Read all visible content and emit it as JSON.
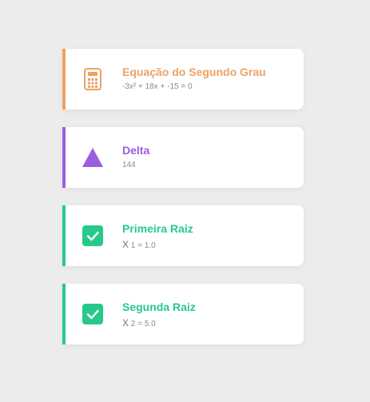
{
  "colors": {
    "background": "#ececec",
    "equation_accent": "#eba266",
    "delta_accent": "#9c5ce0",
    "root_accent": "#27c98a"
  },
  "cards": [
    {
      "icon": "calculator-icon",
      "title": "Equação do Segundo Grau",
      "subtitle": "-3x² + 18x + -15 = 0"
    },
    {
      "icon": "triangle-icon",
      "title": "Delta",
      "subtitle": "144"
    },
    {
      "icon": "checkbox-checked-icon",
      "title": "Primeira Raiz",
      "symbol": "X",
      "subtitle": "1 = 1.0"
    },
    {
      "icon": "checkbox-checked-icon",
      "title": "Segunda Raiz",
      "symbol": "X",
      "subtitle": "2 = 5.0"
    }
  ]
}
